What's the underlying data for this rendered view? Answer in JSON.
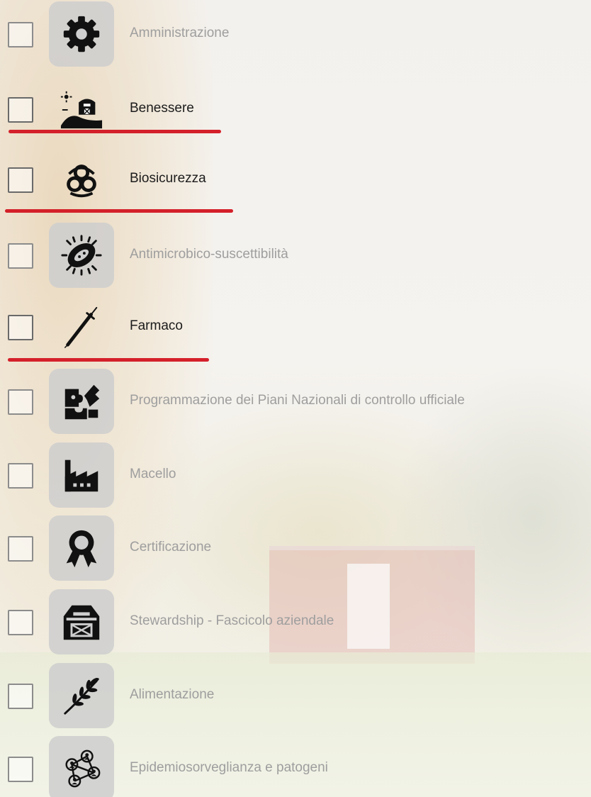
{
  "items": [
    {
      "label": "Amministrazione",
      "icon": "gear-icon",
      "checked": false,
      "active": false
    },
    {
      "label": "Benessere",
      "icon": "farm-barn-sun-icon",
      "checked": false,
      "active": true
    },
    {
      "label": "Biosicurezza",
      "icon": "biohazard-icon",
      "checked": false,
      "active": true
    },
    {
      "label": "Antimicrobico-suscettibilità",
      "icon": "bacteria-icon",
      "checked": false,
      "active": false
    },
    {
      "label": "Farmaco",
      "icon": "syringe-icon",
      "checked": false,
      "active": true
    },
    {
      "label": "Programmazione dei Piani Nazionali di controllo ufficiale",
      "icon": "puzzle-map-icon",
      "checked": false,
      "active": false
    },
    {
      "label": "Macello",
      "icon": "factory-icon",
      "checked": false,
      "active": false
    },
    {
      "label": "Certificazione",
      "icon": "award-ribbon-icon",
      "checked": false,
      "active": false
    },
    {
      "label": "Stewardship - Fascicolo aziendale",
      "icon": "barn-icon",
      "checked": false,
      "active": false
    },
    {
      "label": "Alimentazione",
      "icon": "wheat-icon",
      "checked": false,
      "active": false
    },
    {
      "label": "Epidemiosorveglianza e patogeni",
      "icon": "network-people-icon",
      "checked": false,
      "active": false
    }
  ],
  "colors": {
    "highlight_underline": "#d4202a",
    "active_text": "#1c1c1c",
    "inactive_text": "#9e9e9e",
    "icon_tile": "#cecece"
  }
}
